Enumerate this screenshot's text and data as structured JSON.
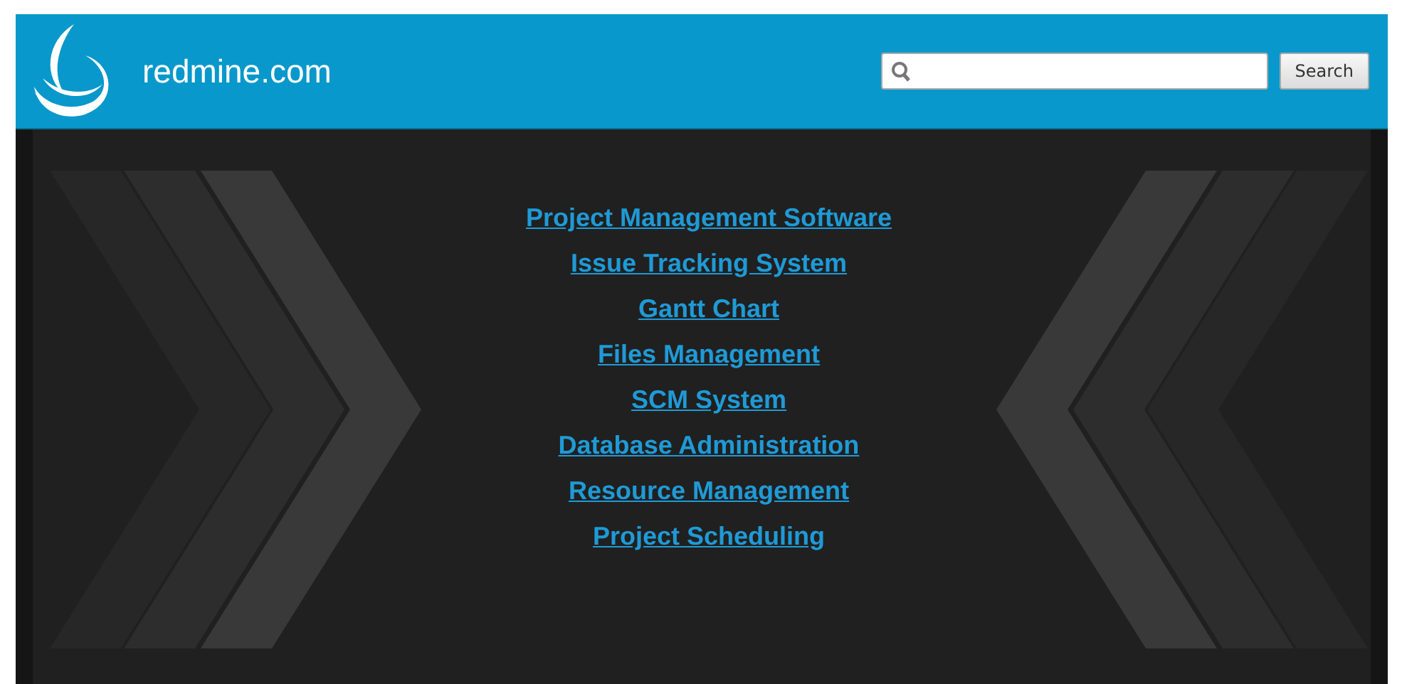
{
  "header": {
    "site_name": "redmine.com",
    "search_button": "Search"
  },
  "links": [
    "Project Management Software",
    "Issue Tracking System",
    "Gantt Chart",
    "Files Management",
    "SCM System",
    "Database Administration",
    "Resource Management",
    "Project Scheduling"
  ]
}
